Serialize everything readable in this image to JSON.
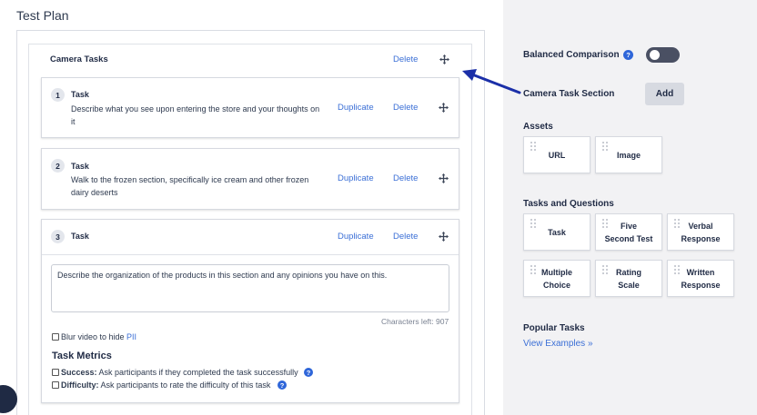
{
  "page": {
    "title": "Test Plan"
  },
  "section": {
    "title": "Camera Tasks",
    "delete_label": "Delete"
  },
  "tasks": [
    {
      "number": "1",
      "label": "Task",
      "description_line1": "Describe what you see upon entering the store and your thoughts on",
      "description_line2": "it",
      "duplicate_label": "Duplicate",
      "delete_label": "Delete"
    },
    {
      "number": "2",
      "label": "Task",
      "description_line1": "Walk to the frozen section, specifically ice cream and other frozen",
      "description_line2": "dairy deserts",
      "duplicate_label": "Duplicate",
      "delete_label": "Delete"
    },
    {
      "number": "3",
      "label": "Task",
      "duplicate_label": "Duplicate",
      "delete_label": "Delete",
      "textarea_value": "Describe the organization of the products in this section and any opinions you have on this.",
      "chars_left": "Characters left: 907",
      "blur_label_prefix": "Blur video to hide ",
      "blur_label_link": "PII",
      "metrics_title": "Task Metrics",
      "success_bold": "Success:",
      "success_text": " Ask participants if they completed the task successfully",
      "difficulty_bold": "Difficulty:",
      "difficulty_text": " Ask participants to rate the difficulty of this task"
    }
  ],
  "right_panel": {
    "balanced_label": "Balanced Comparison",
    "camera_section_label": "Camera Task Section",
    "add_label": "Add",
    "assets_title": "Assets",
    "assets": [
      "URL",
      "Image"
    ],
    "tasks_title": "Tasks and Questions",
    "tasks_items": [
      {
        "line1": "Task",
        "line2": ""
      },
      {
        "line1": "Five",
        "line2": "Second Test"
      },
      {
        "line1": "Verbal",
        "line2": "Response"
      },
      {
        "line1": "Multiple",
        "line2": "Choice"
      },
      {
        "line1": "Rating",
        "line2": "Scale"
      },
      {
        "line1": "Written",
        "line2": "Response"
      }
    ],
    "popular_title": "Popular Tasks",
    "view_examples": "View Examples »"
  },
  "colors": {
    "accent": "#3b6fd6",
    "arrow": "#1b2fa8",
    "toggle_off": "#4a5063"
  },
  "icons": {
    "move": "move-icon",
    "help": "help-icon",
    "grip": "grip-icon"
  }
}
